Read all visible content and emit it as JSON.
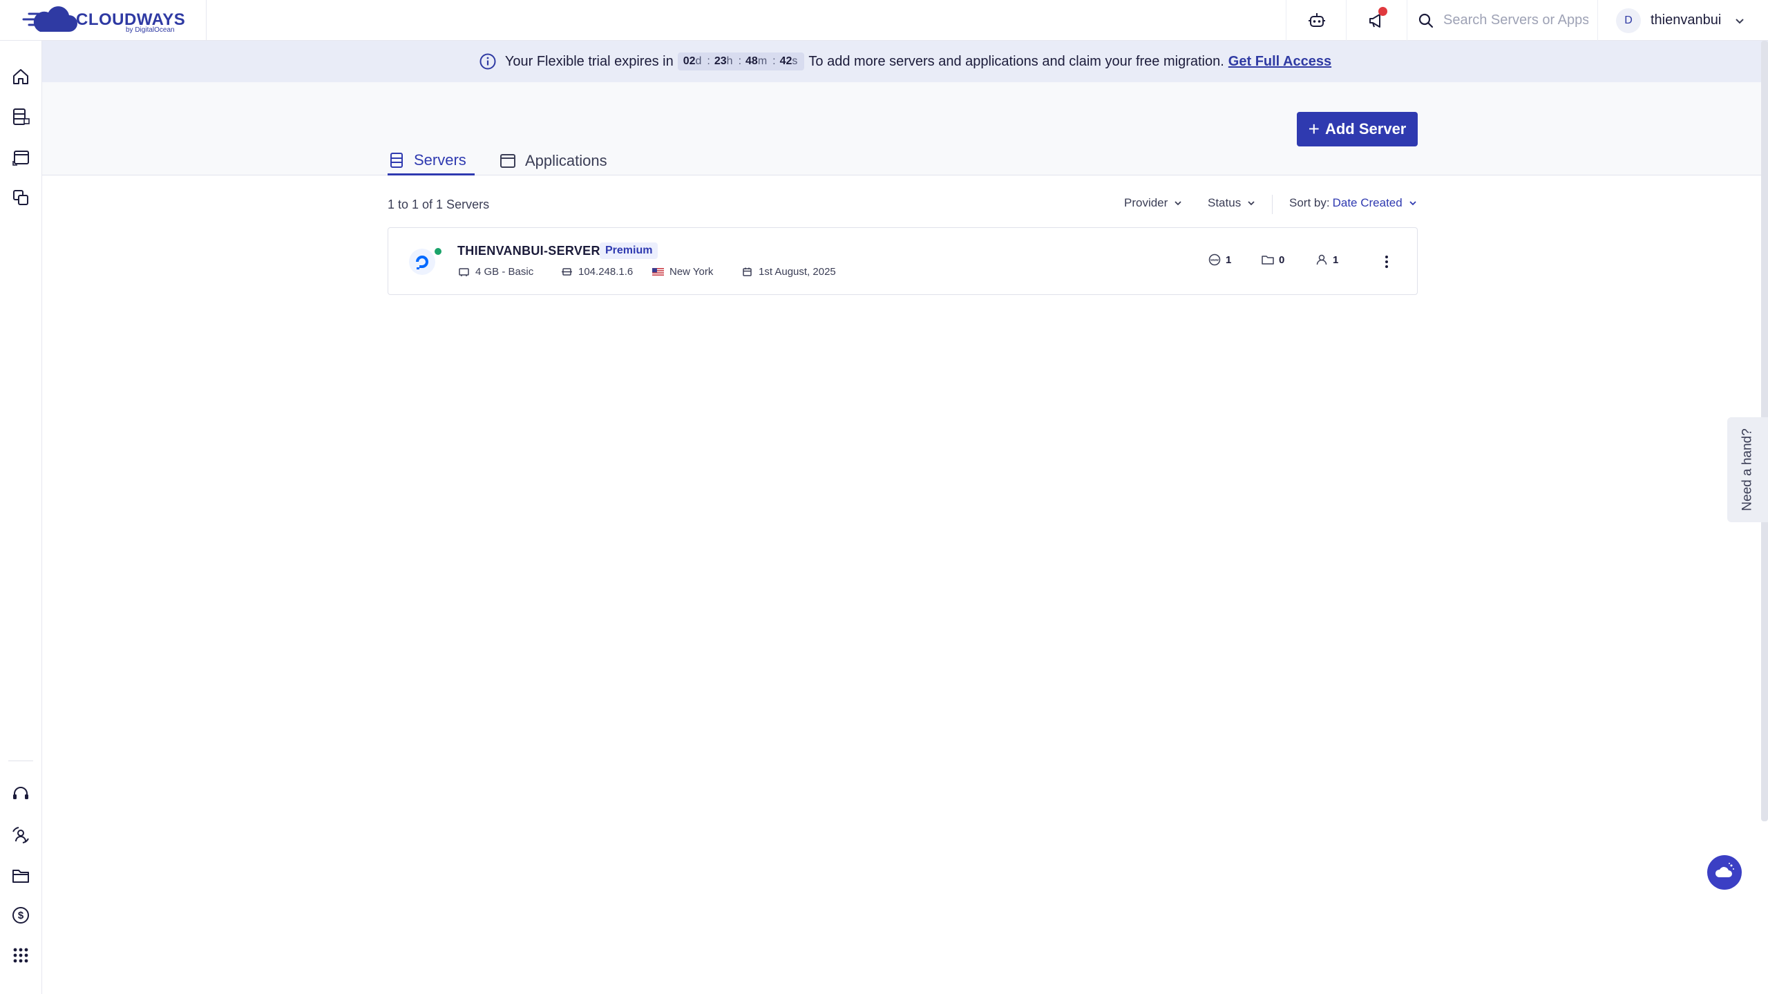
{
  "brand": {
    "name": "CLOUDWAYS",
    "sub": "by DigitalOcean",
    "color": "#2f3aa3"
  },
  "header": {
    "search_placeholder": "Search Servers or Apps",
    "user_initial": "D",
    "username": "thienvanbui"
  },
  "banner": {
    "prefix": "Your Flexible trial expires in",
    "timer": {
      "days": "02",
      "days_unit": "d",
      "hours": "23",
      "hours_unit": "h",
      "minutes": "48",
      "minutes_unit": "m",
      "seconds": "42",
      "seconds_unit": "s"
    },
    "suffix": "To add more servers and applications and claim your free migration.",
    "link": "Get Full Access"
  },
  "actions": {
    "add_server": "Add Server"
  },
  "tabs": [
    {
      "label": "Servers",
      "active": true
    },
    {
      "label": "Applications",
      "active": false
    }
  ],
  "list": {
    "count_text": "1 to 1 of 1 Servers",
    "filters": {
      "provider": "Provider",
      "status": "Status",
      "sort_label": "Sort by:",
      "sort_value": "Date Created"
    }
  },
  "servers": [
    {
      "name": "THIENVANBUI-SERVER",
      "badge": "Premium",
      "size": "4 GB - Basic",
      "ip": "104.248.1.6",
      "location": "New York",
      "created": "1st August, 2025",
      "status_color": "#1aa36a",
      "stats": {
        "apps": "1",
        "projects": "0",
        "users": "1"
      }
    }
  ],
  "widgets": {
    "need_hand": "Need a hand?"
  },
  "colors": {
    "accent": "#2f3ab0",
    "banner_bg": "#e9ecf7",
    "notification": "#e0393e"
  }
}
